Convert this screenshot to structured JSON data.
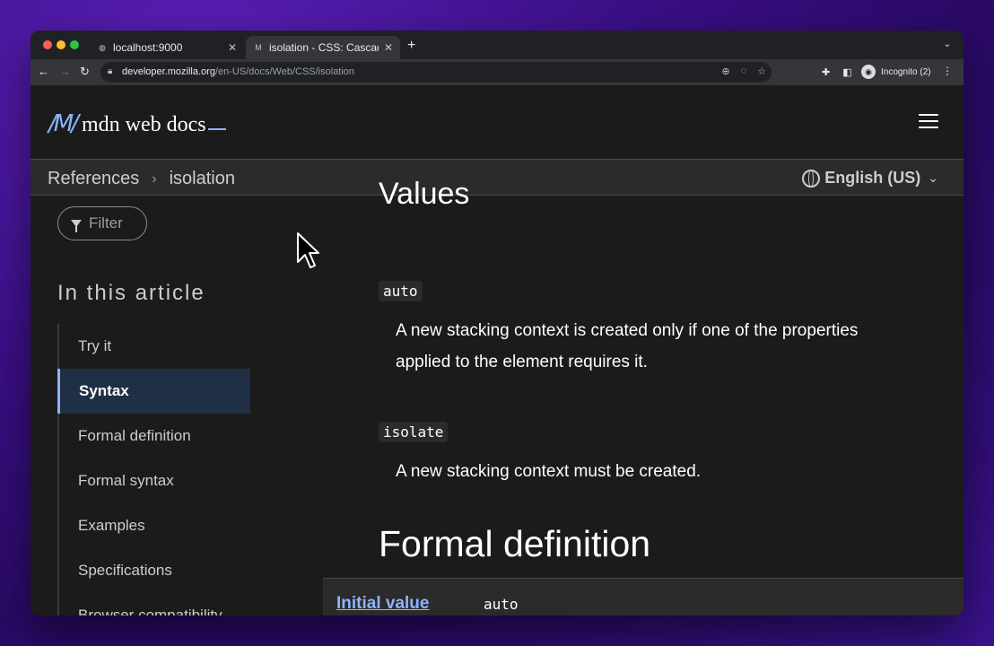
{
  "browser": {
    "tabs": [
      {
        "title": "localhost:9000",
        "favicon": "globe-icon"
      },
      {
        "title": "isolation - CSS: Cascadi",
        "favicon": "mdn-icon",
        "active": true
      }
    ],
    "url_host": "developer.mozilla.org",
    "url_path": "/en-US/docs/Web/CSS/isolation",
    "profile_label": "Incognito (2)"
  },
  "site": {
    "logo_mark": "M",
    "logo_text": "mdn web docs"
  },
  "breadcrumb": {
    "items": [
      "References",
      "isolation"
    ]
  },
  "language": {
    "label": "English (US)"
  },
  "sidebar": {
    "filter_placeholder": "Filter",
    "toc_title": "In this article",
    "items": [
      {
        "label": "Try it"
      },
      {
        "label": "Syntax",
        "active": true
      },
      {
        "label": "Formal definition"
      },
      {
        "label": "Formal syntax"
      },
      {
        "label": "Examples"
      },
      {
        "label": "Specifications"
      },
      {
        "label": "Browser compatibility"
      }
    ]
  },
  "main": {
    "values_heading": "Values",
    "values": [
      {
        "code": "auto",
        "description": "A new stacking context is created only if one of the properties applied to the element requires it."
      },
      {
        "code": "isolate",
        "description": "A new stacking context must be created."
      }
    ],
    "formal_definition_heading": "Formal definition",
    "definition_table": {
      "label": "Initial value",
      "value": "auto"
    }
  },
  "colors": {
    "accent": "#8cb4ff",
    "page_bg": "#1b1b1b",
    "active_toc_bg": "#1f2f45"
  }
}
